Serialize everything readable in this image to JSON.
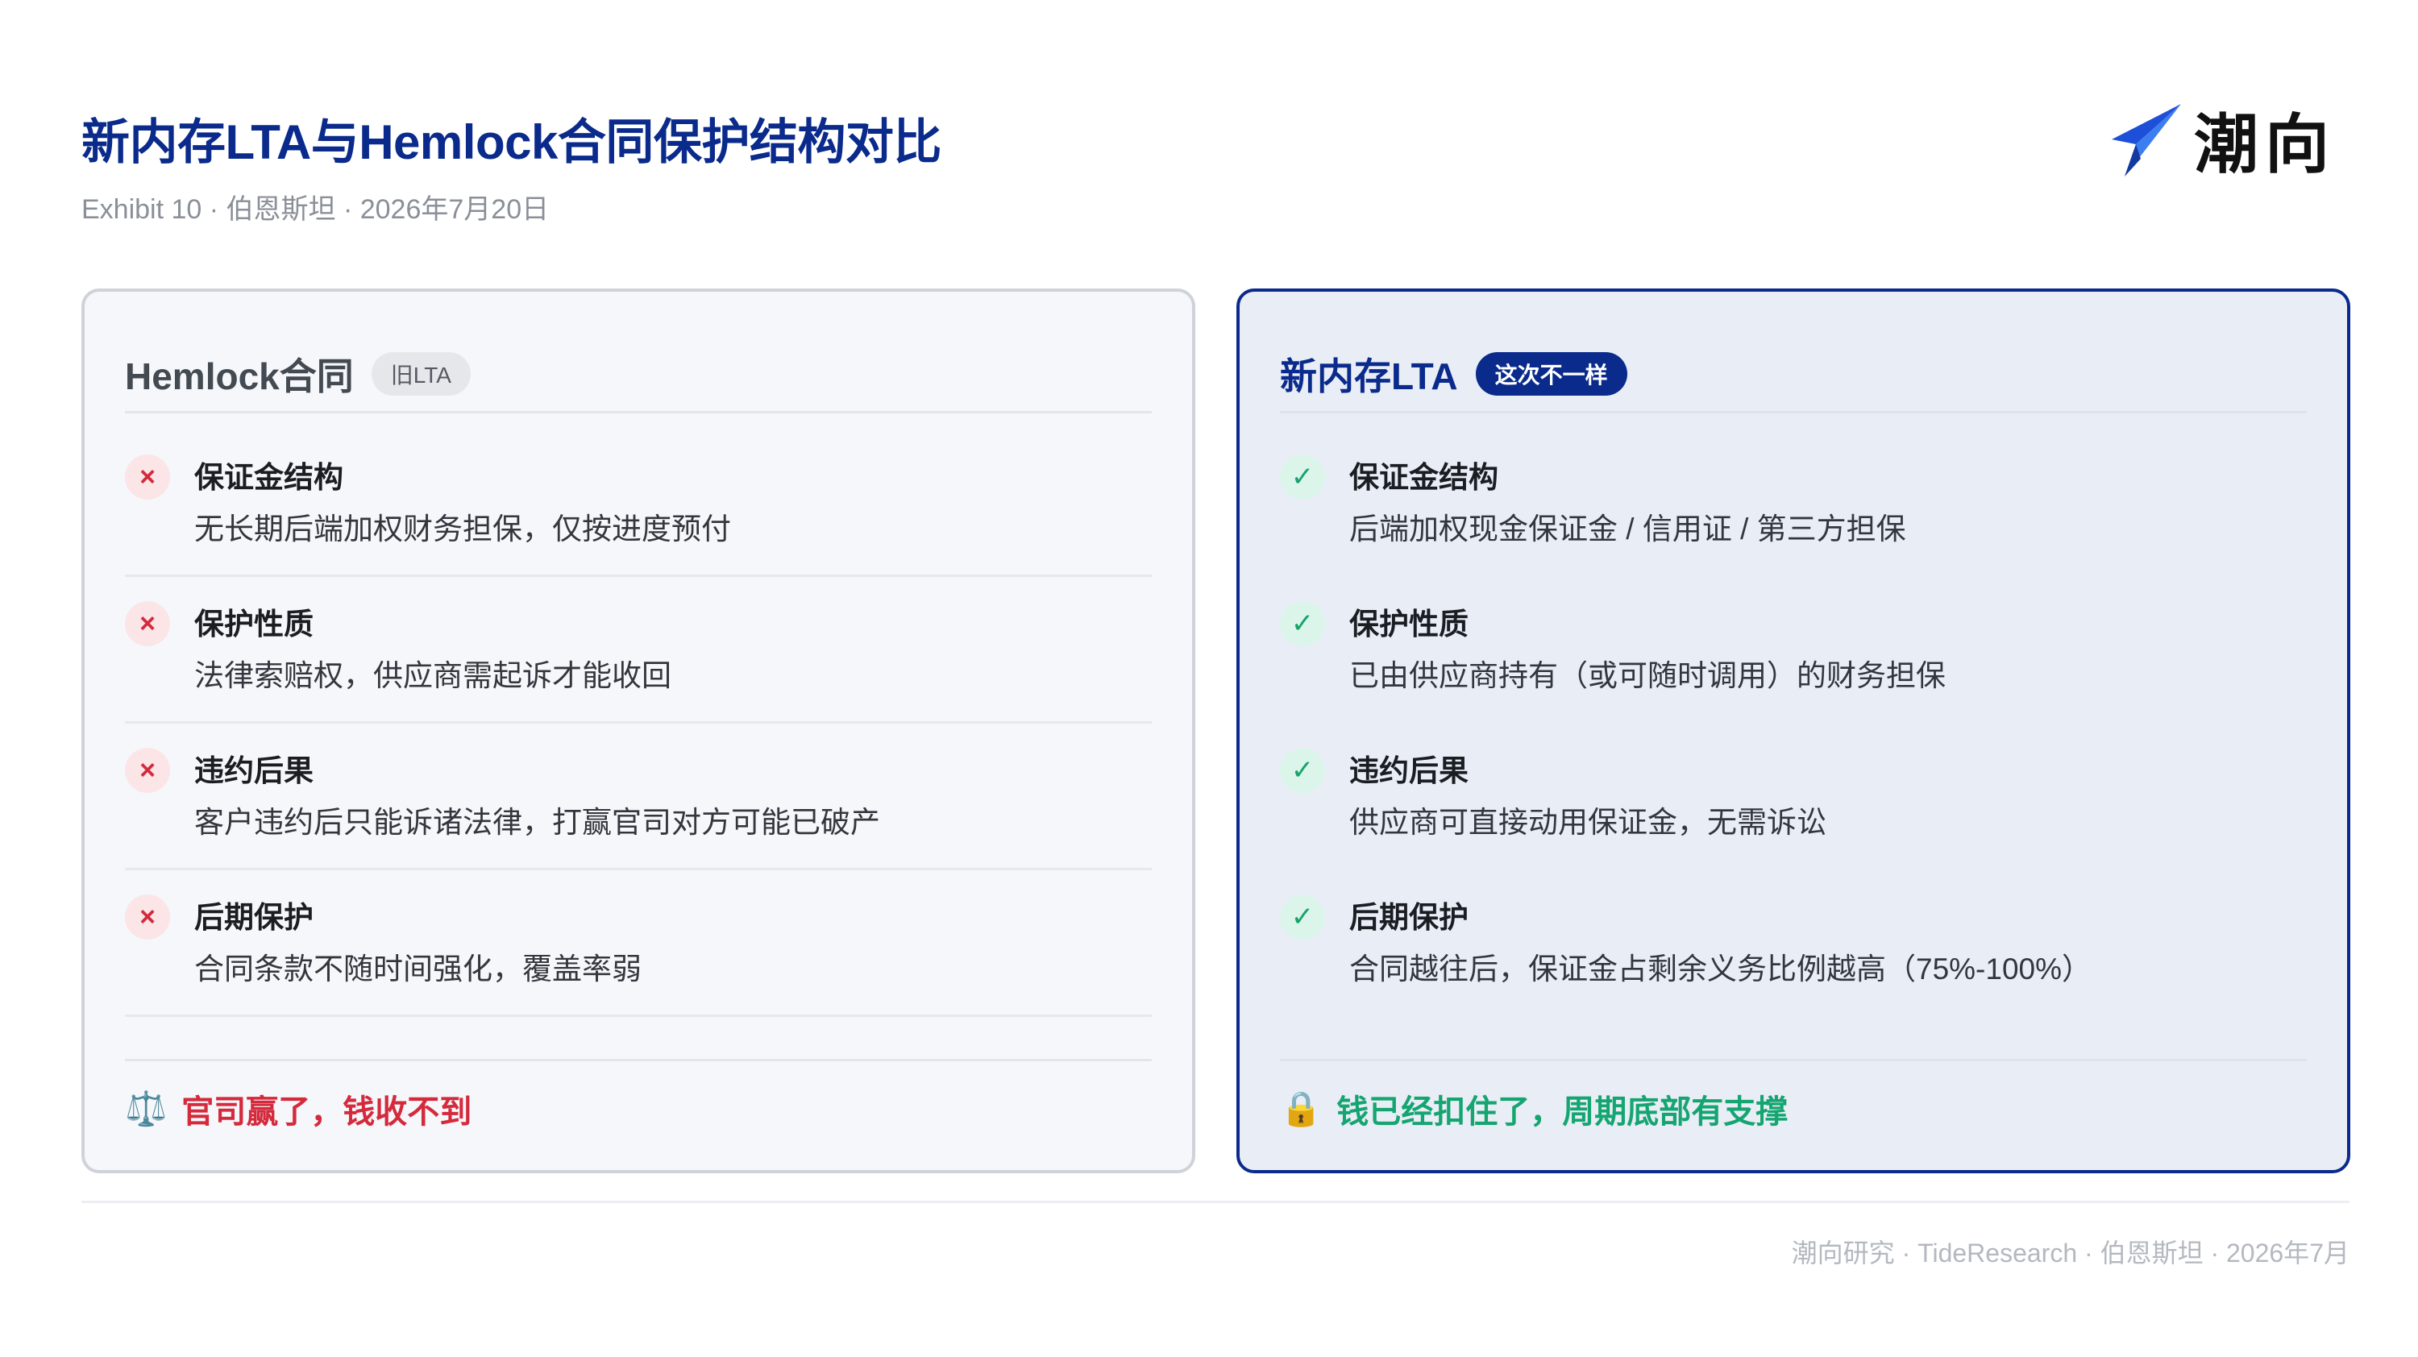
{
  "header": {
    "title": "新内存LTA与Hemlock合同保护结构对比",
    "subtitle": "Exhibit 10 · 伯恩斯坦 · 2026年7月20日",
    "logo_text": "潮向",
    "logo_icon": "arrow-swoosh-icon",
    "brand_color": "#0a2a8c"
  },
  "left_card": {
    "title": "Hemlock合同",
    "tag": "旧LTA",
    "mark_symbol": "×",
    "items": [
      {
        "title": "保证金结构",
        "desc": "无长期后端加权财务担保，仅按进度预付"
      },
      {
        "title": "保护性质",
        "desc": "法律索赔权，供应商需起诉才能收回"
      },
      {
        "title": "违约后果",
        "desc": "客户违约后只能诉诸法律，打赢官司对方可能已破产"
      },
      {
        "title": "后期保护",
        "desc": "合同条款不随时间强化，覆盖率弱"
      }
    ],
    "conclusion_icon": "⚖️",
    "conclusion": "官司赢了，钱收不到",
    "accent": "#d42a3c"
  },
  "right_card": {
    "title": "新内存LTA",
    "tag": "这次不一样",
    "mark_symbol": "✓",
    "items": [
      {
        "title": "保证金结构",
        "desc": "后端加权现金保证金 / 信用证 / 第三方担保"
      },
      {
        "title": "保护性质",
        "desc": "已由供应商持有（或可随时调用）的财务担保"
      },
      {
        "title": "违约后果",
        "desc": "供应商可直接动用保证金，无需诉讼"
      },
      {
        "title": "后期保护",
        "desc": "合同越往后，保证金占剩余义务比例越高（75%-100%）"
      }
    ],
    "conclusion_icon": "🔒",
    "conclusion": "钱已经扣住了，周期底部有支撑",
    "accent": "#15a571"
  },
  "footer": {
    "text": "潮向研究 · TideResearch · 伯恩斯坦 · 2026年7月"
  }
}
